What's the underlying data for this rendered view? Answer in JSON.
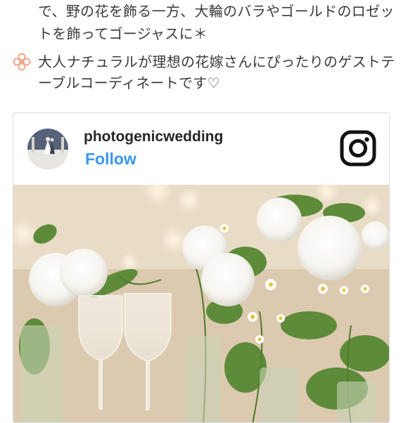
{
  "bullets": [
    {
      "lines": [
        "で、野の花を飾る一方、大輪のバラやゴールドのロゼッ",
        "トを飾ってゴージャスに＊"
      ]
    },
    {
      "icon": "flower-icon",
      "lines": [
        "大人ナチュラルが理想の花嫁さんにぴったりのゲストテ",
        "ーブルコーディネートです♡"
      ]
    }
  ],
  "embed": {
    "username": "photogenicwedding",
    "follow_label": "Follow",
    "logo_icon": "instagram-icon",
    "photo_alt": "table-flowers-and-champagne-photo"
  },
  "colors": {
    "text": "#3a3a3a",
    "accent_flower": "#f3a68c",
    "follow": "#3897f0",
    "border": "#dbdbdb"
  }
}
